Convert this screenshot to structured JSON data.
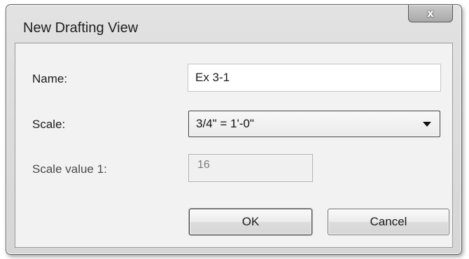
{
  "dialog": {
    "title": "New Drafting View",
    "close_glyph": "x"
  },
  "form": {
    "name_label": "Name:",
    "name_value": "Ex 3-1",
    "scale_label": "Scale:",
    "scale_selected": "3/4\" = 1'-0\"",
    "scale_value_label": "Scale value  1:",
    "scale_value": "16"
  },
  "buttons": {
    "ok": "OK",
    "cancel": "Cancel"
  },
  "icons": {
    "close": "close-icon",
    "dropdown": "chevron-down-icon"
  }
}
